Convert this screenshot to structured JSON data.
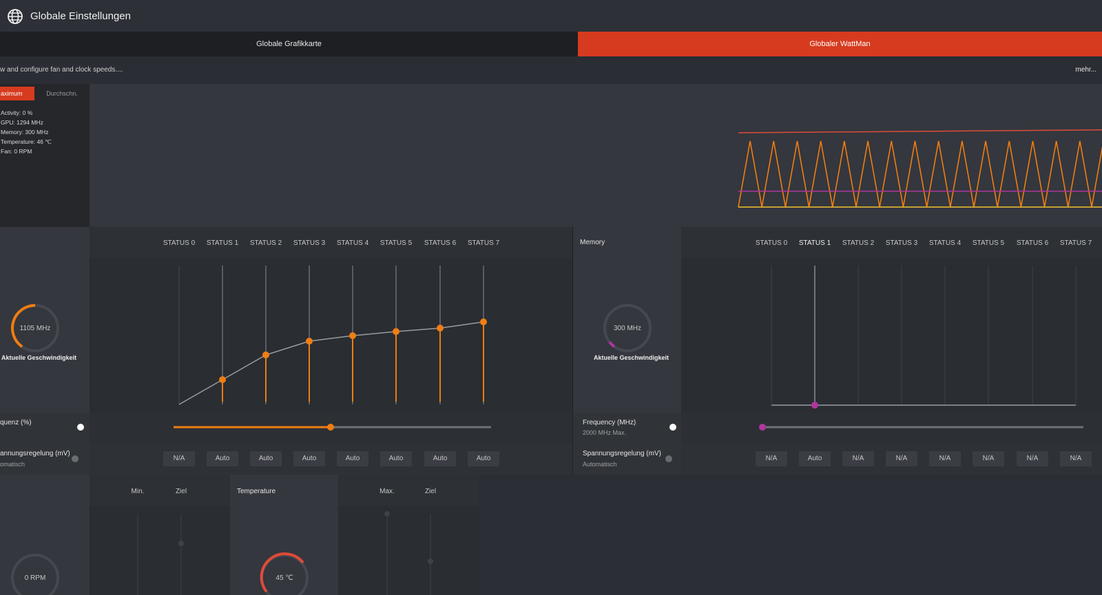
{
  "window": {
    "title": "Globale Einstellungen"
  },
  "tabs": [
    {
      "label": "Globale Grafikkarte",
      "active": false
    },
    {
      "label": "Globaler WattMan",
      "active": true
    }
  ],
  "description": "w and configure fan and clock speeds....",
  "more_link": "mehr...",
  "monitor": {
    "mode_buttons": [
      "aximum",
      "Durchschn."
    ],
    "stats": [
      "Activity: 0 %",
      "GPU: 1294 MHz",
      "Memory: 300 MHz",
      "Temperature: 46 ℃",
      "Fan: 0 RPM"
    ]
  },
  "colors": {
    "accent": "#d63b1f",
    "orange": "#f07d12",
    "magenta": "#b0359e",
    "yellow": "#f2c230",
    "red": "#e04a3a"
  },
  "gpu": {
    "title": "",
    "status_labels": [
      "STATUS 0",
      "STATUS 1",
      "STATUS 2",
      "STATUS 3",
      "STATUS 4",
      "STATUS 5",
      "STATUS 6",
      "STATUS 7"
    ],
    "gauge_value": "1105 MHz",
    "gauge_label": "Aktuelle Geschwindigkeit",
    "frequency_label": "quenz (%)",
    "voltage_label": "annungsregelung (mV)",
    "voltage_sub": "omatisch",
    "voltage_values": [
      "N/A",
      "Auto",
      "Auto",
      "Auto",
      "Auto",
      "Auto",
      "Auto",
      "Auto"
    ]
  },
  "memory": {
    "title": "Memory",
    "status_labels": [
      "STATUS 0",
      "STATUS 1",
      "STATUS 2",
      "STATUS 3",
      "STATUS 4",
      "STATUS 5",
      "STATUS 6",
      "STATUS 7"
    ],
    "gauge_value": "300 MHz",
    "gauge_label": "Aktuelle Geschwindigkeit",
    "frequency_label": "Frequency (MHz)",
    "frequency_sub": "2000 MHz Max.",
    "voltage_label": "Spannungsregelung (mV)",
    "voltage_sub": "Automatisch",
    "voltage_values": [
      "N/A",
      "Auto",
      "N/A",
      "N/A",
      "N/A",
      "N/A",
      "N/A",
      "N/A"
    ]
  },
  "fan": {
    "cols": [
      "Min.",
      "Ziel"
    ],
    "gauge_value": "0 RPM"
  },
  "temperature": {
    "title": "Temperature",
    "cols": [
      "Max.",
      "Ziel"
    ],
    "gauge_value": "45 ℃"
  }
}
